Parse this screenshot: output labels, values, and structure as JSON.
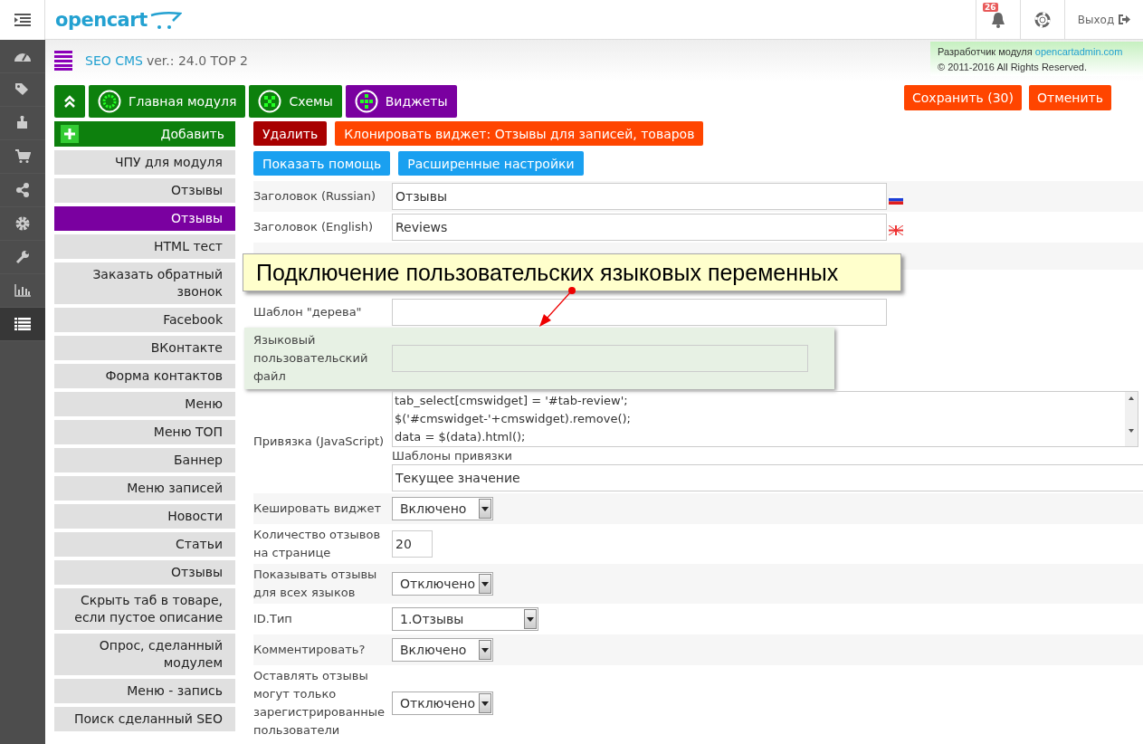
{
  "nav_items": [
    {
      "kind": "dashboard",
      "selected": false
    },
    {
      "kind": "tags",
      "selected": false
    },
    {
      "kind": "puzzle",
      "selected": false
    },
    {
      "kind": "cart",
      "selected": false
    },
    {
      "kind": "share",
      "selected": false
    },
    {
      "kind": "gear",
      "selected": false
    },
    {
      "kind": "wrench",
      "selected": false
    },
    {
      "kind": "chart",
      "selected": false
    },
    {
      "kind": "list",
      "selected": true
    }
  ],
  "header": {
    "logo": "opencart",
    "notifications": "26",
    "logout": "Выход"
  },
  "module": {
    "name": "SEO CMS",
    "version": "ver.: 24.0 TOP 2",
    "developer_label": "Разработчик модуля",
    "developer_link": "opencartadmin.com",
    "copyright": "© 2011-2016 All Rights Reserved."
  },
  "tabs": [
    {
      "label": "Главная модуля",
      "kind": "ring",
      "selected": false
    },
    {
      "label": "Схемы",
      "kind": "checker",
      "selected": false
    },
    {
      "label": "Виджеты",
      "kind": "diamond",
      "selected": true
    }
  ],
  "actions": [
    {
      "label": "Сохранить (30)"
    },
    {
      "label": "Отменить"
    }
  ],
  "widgets": {
    "add": "Добавить",
    "items": [
      {
        "label": "ЧПУ для модуля",
        "selected": false
      },
      {
        "label": "Отзывы",
        "selected": false
      },
      {
        "label": "Отзывы",
        "selected": true
      },
      {
        "label": "HTML тест",
        "selected": false
      },
      {
        "label": "Заказать обратный звонок",
        "selected": false
      },
      {
        "label": "Facebook",
        "selected": false
      },
      {
        "label": "ВКонтакте",
        "selected": false
      },
      {
        "label": "Форма контактов",
        "selected": false
      },
      {
        "label": "Меню",
        "selected": false
      },
      {
        "label": "Меню ТОП",
        "selected": false
      },
      {
        "label": "Баннер",
        "selected": false
      },
      {
        "label": "Меню записей",
        "selected": false
      },
      {
        "label": "Новости",
        "selected": false
      },
      {
        "label": "Статьи",
        "selected": false
      },
      {
        "label": "Отзывы",
        "selected": false
      },
      {
        "label": "Скрыть таб в товаре, если пустое описание",
        "selected": false
      },
      {
        "label": "Опрос, сделанный модулем",
        "selected": false
      },
      {
        "label": "Меню - запись",
        "selected": false
      },
      {
        "label": "Поиск сделанный SEO",
        "selected": false
      }
    ]
  },
  "widget_buttons": [
    {
      "label": "Удалить",
      "kind": "danger"
    },
    {
      "label": "Клонировать виджет: Отзывы для записей, товаров",
      "kind": "warn"
    },
    {
      "label": "Показать помощь",
      "kind": "info"
    },
    {
      "label": "Расширенные настройки",
      "kind": "info"
    }
  ],
  "fields_top": [
    {
      "label": "Заголовок (Russian)",
      "kind": "russian_flag",
      "value": "Отзывы"
    },
    {
      "label": "Заголовок (English)",
      "kind": "english_flag",
      "value": "Reviews"
    }
  ],
  "callout": "Подключение пользовательских языковых переменных",
  "fields": [
    {
      "label": "Шаблон \"дерева\"",
      "kind": "text",
      "highlighted": false
    },
    {
      "label": "Языковый пользовательский файл",
      "kind": "file",
      "highlighted": true
    },
    {
      "label": "Привязка (JavaScript)",
      "kind": "code",
      "lines": [
        "tab_select[cmswidget] = '#tab-review';",
        "$('#cmswidget-'+cmswidget).remove();",
        "data = $(data).html();"
      ],
      "sublabel": "Шаблоны привязки",
      "value": "Текущее значение",
      "highlighted": false
    },
    {
      "label": "Кешировать виджет",
      "kind": "select",
      "value": "Включено",
      "highlighted": false
    },
    {
      "label": "Количество отзывов на странице",
      "kind": "number",
      "value": "20",
      "highlighted": false
    },
    {
      "label": "Показывать отзывы для всех языков",
      "kind": "select",
      "value": "Отключено",
      "highlighted": false
    },
    {
      "label": "ID.Тип",
      "kind": "wideselect",
      "value": "1.Отзывы",
      "highlighted": false
    },
    {
      "label": "Комментировать?",
      "kind": "select",
      "value": "Включено",
      "highlighted": false
    },
    {
      "label": "Оставлять отзывы могут только зарегистрированные пользователи",
      "kind": "select",
      "value": "Отключено",
      "highlighted": false
    }
  ]
}
